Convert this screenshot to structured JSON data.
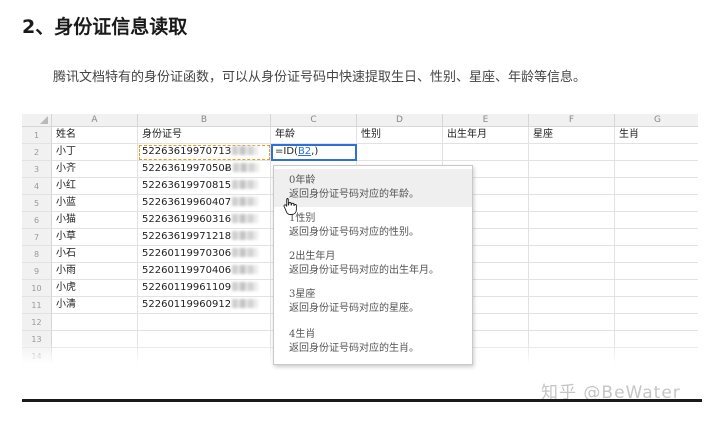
{
  "heading": "2、身份证信息读取",
  "intro": "腾讯文档特有的身份证函数，可以从身份证号码中快速提取生日、性别、星座、年龄等信息。",
  "columns": [
    "A",
    "B",
    "C",
    "D",
    "E",
    "F",
    "G"
  ],
  "row_numbers": [
    "1",
    "2",
    "3",
    "4",
    "5",
    "6",
    "7",
    "8",
    "9",
    "10",
    "11",
    "12",
    "13",
    "14"
  ],
  "header_row": [
    "姓名",
    "身份证号",
    "年龄",
    "性别",
    "出生年月",
    "星座",
    "生肖"
  ],
  "rows": [
    {
      "name": "小丁",
      "id": "5226361997071З"
    },
    {
      "name": "小齐",
      "id": "5226361997050Ƀ"
    },
    {
      "name": "小红",
      "id": "52263619970815"
    },
    {
      "name": "小蓝",
      "id": "52263619960407"
    },
    {
      "name": "小猫",
      "id": "52263619960316"
    },
    {
      "name": "小草",
      "id": "52263619971218"
    },
    {
      "name": "小石",
      "id": "52260119970306"
    },
    {
      "name": "小雨",
      "id": "52260119970406"
    },
    {
      "name": "小虎",
      "id": "52260119961109"
    },
    {
      "name": "小清",
      "id": "52260119960912"
    }
  ],
  "formula": {
    "prefix": "=ID(",
    "ref": "B2",
    "suffix": ",)"
  },
  "suggestions": [
    {
      "name": "0年龄",
      "desc": "返回身份证号码对应的年龄。"
    },
    {
      "name": "1性别",
      "desc": "返回身份证号码对应的性别。"
    },
    {
      "name": "2出生年月",
      "desc": "返回身份证号码对应的出生年月。"
    },
    {
      "name": "3星座",
      "desc": "返回身份证号码对应的星座。"
    },
    {
      "name": "4生肖",
      "desc": "返回身份证号码对应的生肖。"
    }
  ],
  "active_suggestion_index": 0,
  "watermark": "知乎 @BeWater",
  "colors": {
    "reference_highlight": "#f09a1a",
    "editing_border": "#2e6fd9"
  }
}
